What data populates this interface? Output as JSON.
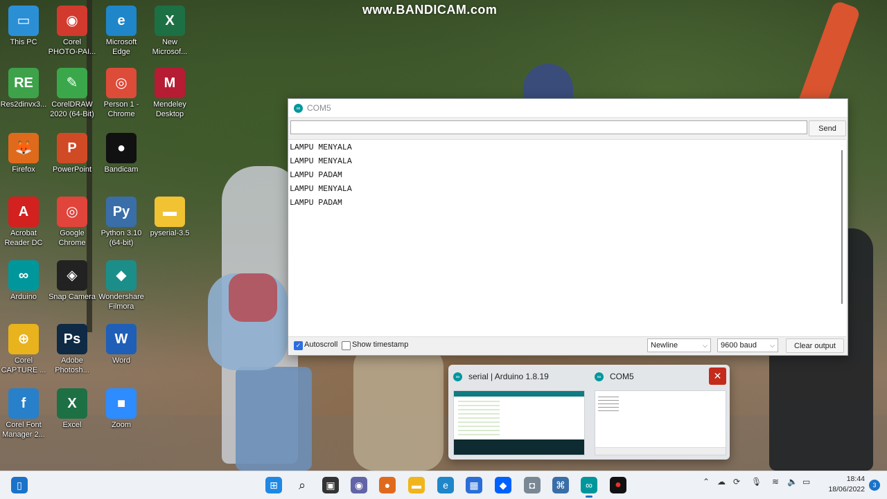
{
  "watermark": "www.BANDICAM.com",
  "desktop_icons": [
    {
      "label": "This PC",
      "glyph": "▭",
      "color": "#2b8fd6"
    },
    {
      "label": "Corel PHOTO-PAI...",
      "glyph": "◉",
      "color": "#d23a2e"
    },
    {
      "label": "Microsoft Edge",
      "glyph": "e",
      "color": "#1f86c9"
    },
    {
      "label": "New Microsof...",
      "glyph": "X",
      "color": "#1d7044"
    },
    {
      "label": "Res2dinvx3...",
      "glyph": "RE",
      "color": "#3da24a"
    },
    {
      "label": "CorelDRAW 2020 (64-Bit)",
      "glyph": "✎",
      "color": "#3aa84a"
    },
    {
      "label": "Person 1 - Chrome",
      "glyph": "◎",
      "color": "#dd4b39"
    },
    {
      "label": "Mendeley Desktop",
      "glyph": "M",
      "color": "#b61c33"
    },
    {
      "label": "Firefox",
      "glyph": "🦊",
      "color": "#e06a1c"
    },
    {
      "label": "PowerPoint",
      "glyph": "P",
      "color": "#d04a25"
    },
    {
      "label": "Bandicam",
      "glyph": "●",
      "color": "#111111"
    },
    {
      "label": "Acrobat Reader DC",
      "glyph": "A",
      "color": "#d2211f"
    },
    {
      "label": "Google Chrome",
      "glyph": "◎",
      "color": "#e0443a"
    },
    {
      "label": "Python 3.10 (64-bit)",
      "glyph": "Py",
      "color": "#3a6ea8"
    },
    {
      "label": "pyserial-3.5",
      "glyph": "▬",
      "color": "#f1c232"
    },
    {
      "label": "Arduino",
      "glyph": "∞",
      "color": "#00979c"
    },
    {
      "label": "Snap Camera",
      "glyph": "◈",
      "color": "#222222"
    },
    {
      "label": "Wondershare Filmora",
      "glyph": "◆",
      "color": "#1b8e8a"
    },
    {
      "label": "Corel CAPTURE ...",
      "glyph": "⊕",
      "color": "#e8b31c"
    },
    {
      "label": "Adobe Photosh...",
      "glyph": "Ps",
      "color": "#0e2a45"
    },
    {
      "label": "Word",
      "glyph": "W",
      "color": "#1f5fb8"
    },
    {
      "label": "Corel Font Manager 2...",
      "glyph": "f",
      "color": "#2780c9"
    },
    {
      "label": "Excel",
      "glyph": "X",
      "color": "#1d7044"
    },
    {
      "label": "Zoom",
      "glyph": "■",
      "color": "#2d8cff"
    }
  ],
  "serial_monitor": {
    "title": "COM5",
    "input_value": "",
    "send_label": "Send",
    "output_lines": [
      "LAMPU MENYALA",
      "LAMPU MENYALA",
      "LAMPU PADAM",
      "LAMPU MENYALA",
      "LAMPU PADAM"
    ],
    "autoscroll_label": "Autoscroll",
    "autoscroll_checked": true,
    "timestamp_label": "Show timestamp",
    "timestamp_checked": false,
    "line_ending": "Newline",
    "baud": "9600 baud",
    "clear_label": "Clear output"
  },
  "preview": {
    "items": [
      {
        "title": "serial | Arduino 1.8.19"
      },
      {
        "title": "COM5"
      }
    ],
    "close_glyph": "✕"
  },
  "taskbar": {
    "time": "18:44",
    "date": "18/06/2022",
    "notifications": "3"
  },
  "colors": {
    "arduino_teal": "#00979c",
    "close_red": "#c42b1c",
    "check_blue": "#2d6ee0"
  }
}
